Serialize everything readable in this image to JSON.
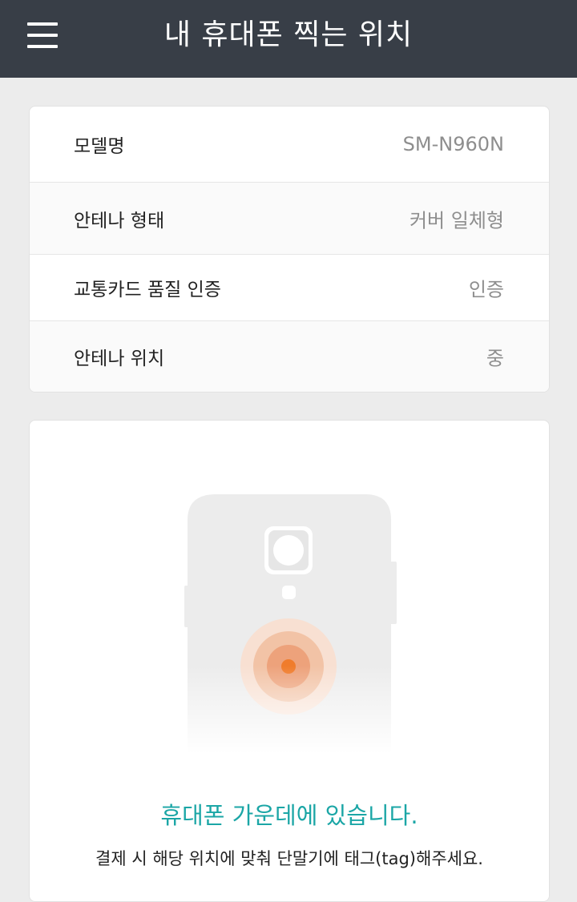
{
  "header": {
    "title": "내 휴대폰 찍는 위치",
    "menu_icon": "hamburger-menu-icon"
  },
  "info": {
    "rows": [
      {
        "label": "모델명",
        "value": "SM-N960N"
      },
      {
        "label": "안테나 형태",
        "value": "커버 일체형"
      },
      {
        "label": "교통카드 품질 인증",
        "value": "인증"
      },
      {
        "label": "안테나 위치",
        "value": "중"
      }
    ]
  },
  "location": {
    "illustration": "phone-back-nfc-icon",
    "status": "휴대폰 가운데에 있습니다.",
    "guide": "결제 시 해당 위치에 맞춰 단말기에 태그(tag)해주세요.",
    "colors": {
      "status": "#1ba6a6",
      "antenna_dot": "#f07c2c",
      "header_bg": "#383e47"
    }
  }
}
